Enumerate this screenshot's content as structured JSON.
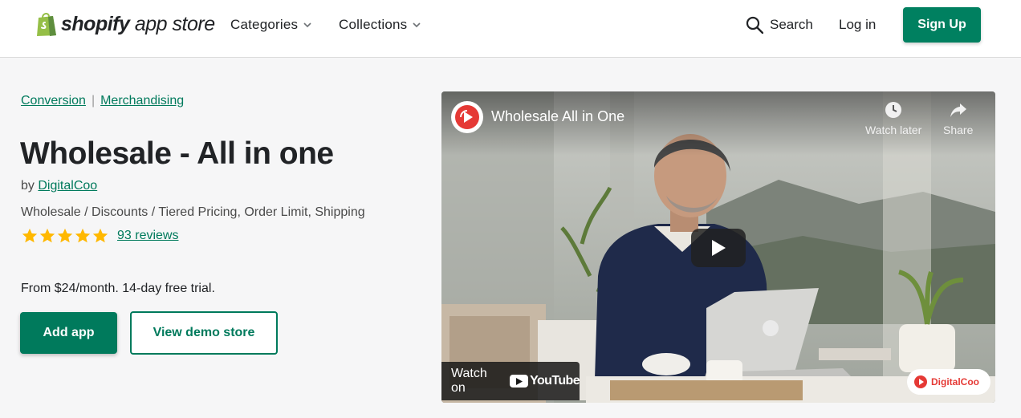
{
  "header": {
    "logo": {
      "brand": "shopify",
      "suffix": "app store"
    },
    "nav": [
      {
        "label": "Categories"
      },
      {
        "label": "Collections"
      }
    ],
    "search_label": "Search",
    "login_label": "Log in",
    "signup_label": "Sign Up"
  },
  "breadcrumb": {
    "items": [
      "Conversion",
      "Merchandising"
    ],
    "separator": "|"
  },
  "app": {
    "title": "Wholesale - All in one",
    "by_prefix": "by",
    "developer": "DigitalCoo",
    "tags": "Wholesale / Discounts / Tiered Pricing, Order Limit, Shipping",
    "rating_stars": 5,
    "reviews_label": "93 reviews",
    "pricing": "From $24/month. 14-day free trial."
  },
  "actions": {
    "add_app": "Add app",
    "view_demo": "View demo store"
  },
  "video": {
    "title": "Wholesale All in One",
    "watch_later": "Watch later",
    "share": "Share",
    "watch_on": "Watch on",
    "youtube": "YouTube",
    "watermark": "DigitalCoo"
  },
  "colors": {
    "brand_green": "#008060",
    "link_green": "#007a5c",
    "star": "#ffb800",
    "youtube_red": "#ff0000"
  }
}
